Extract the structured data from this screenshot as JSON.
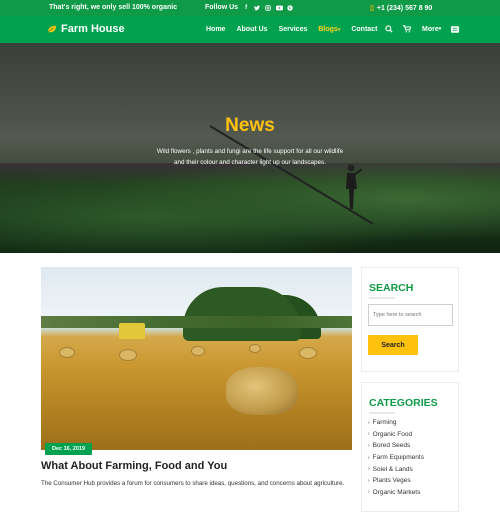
{
  "topbar": {
    "tagline": "That's right, we only sell 100% organic",
    "follow_label": "Follow Us",
    "social_icons": [
      "facebook-icon",
      "twitter-icon",
      "instagram-icon",
      "youtube-icon",
      "pinterest-icon"
    ],
    "phone": "+1 (234) 567 8 90"
  },
  "navbar": {
    "brand": "Farm House",
    "menu": [
      {
        "label": "Home"
      },
      {
        "label": "About Us"
      },
      {
        "label": "Services"
      },
      {
        "label": "Blogs",
        "suffix": "▾",
        "active": true
      },
      {
        "label": "Contact"
      }
    ],
    "more_label": "More",
    "more_suffix": "▾"
  },
  "hero": {
    "title": "News",
    "subtitle_line1": "Wild flowers , plants and fungi are the life support for all our wildlife",
    "subtitle_line2": "and their colour and character light up our landscapes."
  },
  "post": {
    "date": "Dec 16, 2019",
    "title": "What About Farming, Food and You",
    "excerpt": "The Consumer Hub provides a forum for consumers to share ideas, questions, and concerns about agriculture."
  },
  "sidebar": {
    "search_title": "SEARCH",
    "search_placeholder": "Type here to search",
    "search_button": "Search",
    "categories_title": "CATEGORIES",
    "categories": [
      "Farming",
      "Organic Food",
      "Bored Seeds",
      "Farm Equipments",
      "Soiel & Lands",
      "Plants Veges",
      "Organic Markets"
    ]
  },
  "colors": {
    "green": "#00a24f",
    "yellow": "#ffc20e"
  }
}
